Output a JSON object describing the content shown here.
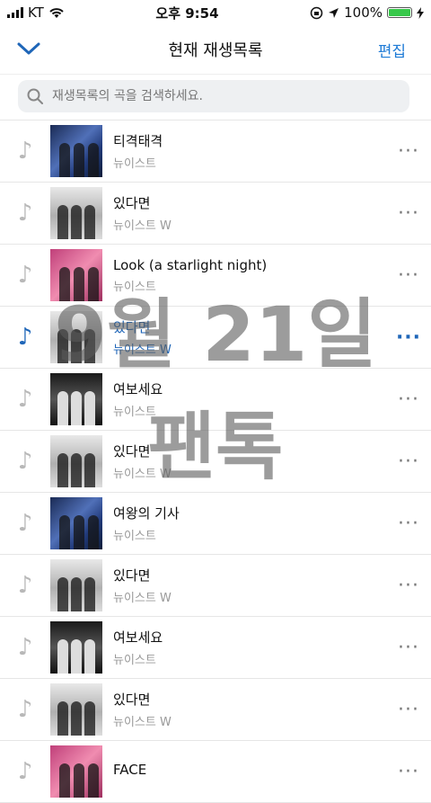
{
  "status": {
    "carrier": "KT",
    "time": "오후 9:54",
    "battery": "100%",
    "battery_level": 1.0
  },
  "header": {
    "title": "현재 재생목록",
    "edit_label": "편집"
  },
  "search": {
    "placeholder": "재생목록의 곡을 검색하세요."
  },
  "songs": [
    {
      "title": "티격태격",
      "artist": "뉴이스트"
    },
    {
      "title": "있다면",
      "artist": "뉴이스트 W"
    },
    {
      "title": "Look (a starlight night)",
      "artist": "뉴이스트"
    },
    {
      "title": "있다면",
      "artist": "뉴이스트 W"
    },
    {
      "title": "여보세요",
      "artist": "뉴이스트"
    },
    {
      "title": "있다면",
      "artist": "뉴이스트 W"
    },
    {
      "title": "여왕의 기사",
      "artist": "뉴이스트"
    },
    {
      "title": "있다면",
      "artist": "뉴이스트 W"
    },
    {
      "title": "여보세요",
      "artist": "뉴이스트"
    },
    {
      "title": "있다면",
      "artist": "뉴이스트 W"
    },
    {
      "title": "FACE",
      "artist": ""
    }
  ],
  "more_label": "···",
  "note_symbol": "♪",
  "overlay": {
    "line1": "9월 21일",
    "line2": "팬톡"
  },
  "colors": {
    "accent": "#1f7bd6",
    "playing": "#1f66b8",
    "battery": "#37c84a"
  }
}
